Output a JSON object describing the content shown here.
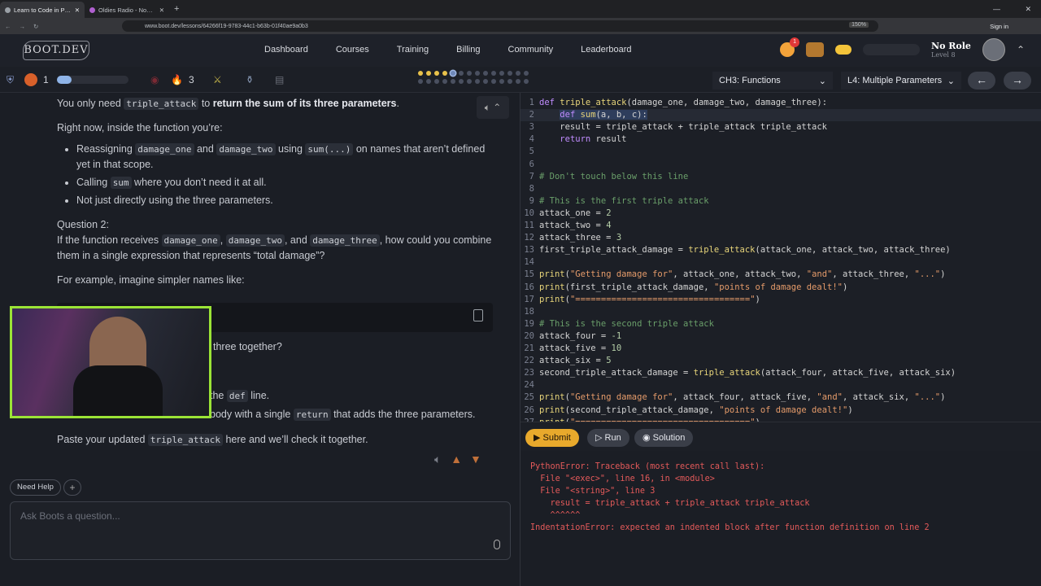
{
  "browser": {
    "tabs": [
      {
        "title": "Learn to Code in Python: N",
        "active": true
      },
      {
        "title": "Oldies Radio - Now Play",
        "active": false
      }
    ],
    "url": "www.boot.dev/lessons/64266f19-9783-44c1-b63b-01f40ae9a0b3",
    "zoom": "150%",
    "signin_label": "Sign in"
  },
  "header": {
    "logo": "BOOT.DEV",
    "nav": [
      "Dashboard",
      "Courses",
      "Training",
      "Billing",
      "Community",
      "Leaderboard"
    ],
    "notification_count": "1",
    "role": "No Role",
    "level": "Level 8"
  },
  "subbar": {
    "gem_count": "1",
    "fire_count": "3",
    "xp_progress": 0.2,
    "chapter": "CH3: Functions",
    "lesson": "L4: Multiple Parameters",
    "progress_rows": [
      [
        "y",
        "y",
        "y",
        "y",
        "c",
        "d",
        "d",
        "d",
        "d",
        "d",
        "d",
        "d",
        "d",
        "d"
      ],
      [
        "d",
        "d",
        "d",
        "d",
        "d",
        "d",
        "d",
        "d",
        "d",
        "d",
        "d",
        "d",
        "d",
        "d"
      ]
    ]
  },
  "chat": {
    "p1_a": "You only need ",
    "p1_code": "triple_attack",
    "p1_b": " to ",
    "p1_bold": "return the sum of its three parameters",
    "p1_c": ".",
    "p2": "Right now, inside the function you’re:",
    "b1_a": "Reassigning ",
    "b1_c1": "damage_one",
    "b1_b": " and ",
    "b1_c2": "damage_two",
    "b1_c": " using ",
    "b1_c3": "sum(...)",
    "b1_d": " on names that aren’t defined yet in that scope.",
    "b2_a": "Calling ",
    "b2_c": "sum",
    "b2_b": " where you don’t need it at all.",
    "b3": "Not just directly using the three parameters.",
    "q2_title": "Question 2:",
    "q2_a": "If the function receives ",
    "q2_c1": "damage_one",
    "q2_sep": ", ",
    "q2_c2": "damage_two",
    "q2_b": ", and ",
    "q2_c3": "damage_three",
    "q2_c": ", how could you combine them in a single expression that represents “total damage”?",
    "p3": "For example, imagine simpler names like:",
    "partial1": "three together?",
    "partial2_a": "the ",
    "partial2_code": "def",
    "partial2_b": " line.",
    "partial3_a": "body with a single ",
    "partial3_code": "return",
    "partial3_b": " that adds the three parameters.",
    "p4_a": "Paste your updated ",
    "p4_code": "triple_attack",
    "p4_b": " here and we’ll check it together.",
    "need_help": "Need Help",
    "ask_placeholder": "Ask Boots a question..."
  },
  "editor_buttons": {
    "submit": "Submit",
    "run": "Run",
    "solution": "Solution"
  },
  "console": [
    "PythonError: Traceback (most recent call last):",
    "  File \"<exec>\", line 16, in <module>",
    "  File \"<string>\", line 3",
    "    result = triple_attack + triple_attack triple_attack",
    "    ^^^^^^",
    "IndentationError: expected an indented block after function definition on line 2"
  ],
  "code_lines": [
    [
      [
        "kw",
        "def "
      ],
      [
        "fn",
        "triple_attack"
      ],
      [
        "var",
        "(damage_one, damage_two, damage_three):"
      ]
    ],
    [
      [
        "var",
        "    "
      ],
      [
        "kw",
        "def "
      ],
      [
        "fn",
        "sum"
      ],
      [
        "var",
        "(a, b, c):"
      ]
    ],
    [
      [
        "var",
        "    result = triple_attack + triple_attack triple_attack"
      ]
    ],
    [
      [
        "var",
        "    "
      ],
      [
        "kw",
        "return"
      ],
      [
        "var",
        " result"
      ]
    ],
    [],
    [],
    [
      [
        "cm",
        "# Don't touch below this line"
      ]
    ],
    [],
    [
      [
        "cm",
        "# This is the first triple attack"
      ]
    ],
    [
      [
        "var",
        "attack_one = "
      ],
      [
        "num",
        "2"
      ]
    ],
    [
      [
        "var",
        "attack_two = "
      ],
      [
        "num",
        "4"
      ]
    ],
    [
      [
        "var",
        "attack_three = "
      ],
      [
        "num",
        "3"
      ]
    ],
    [
      [
        "var",
        "first_triple_attack_damage = "
      ],
      [
        "fn",
        "triple_attack"
      ],
      [
        "var",
        "(attack_one, attack_two, attack_three)"
      ]
    ],
    [],
    [
      [
        "fn",
        "print"
      ],
      [
        "var",
        "("
      ],
      [
        "str",
        "\"Getting damage for\""
      ],
      [
        "var",
        ", attack_one, attack_two, "
      ],
      [
        "str",
        "\"and\""
      ],
      [
        "var",
        ", attack_three, "
      ],
      [
        "str",
        "\"...\""
      ],
      [
        "var",
        ")"
      ]
    ],
    [
      [
        "fn",
        "print"
      ],
      [
        "var",
        "(first_triple_attack_damage, "
      ],
      [
        "str",
        "\"points of damage dealt!\""
      ],
      [
        "var",
        ")"
      ]
    ],
    [
      [
        "fn",
        "print"
      ],
      [
        "var",
        "("
      ],
      [
        "str",
        "\"==================================\""
      ],
      [
        "var",
        ")"
      ]
    ],
    [],
    [
      [
        "cm",
        "# This is the second triple attack"
      ]
    ],
    [
      [
        "var",
        "attack_four = "
      ],
      [
        "num",
        "-1"
      ]
    ],
    [
      [
        "var",
        "attack_five = "
      ],
      [
        "num",
        "10"
      ]
    ],
    [
      [
        "var",
        "attack_six = "
      ],
      [
        "num",
        "5"
      ]
    ],
    [
      [
        "var",
        "second_triple_attack_damage = "
      ],
      [
        "fn",
        "triple_attack"
      ],
      [
        "var",
        "(attack_four, attack_five, attack_six)"
      ]
    ],
    [],
    [
      [
        "fn",
        "print"
      ],
      [
        "var",
        "("
      ],
      [
        "str",
        "\"Getting damage for\""
      ],
      [
        "var",
        ", attack_four, attack_five, "
      ],
      [
        "str",
        "\"and\""
      ],
      [
        "var",
        ", attack_six, "
      ],
      [
        "str",
        "\"...\""
      ],
      [
        "var",
        ")"
      ]
    ],
    [
      [
        "fn",
        "print"
      ],
      [
        "var",
        "(second_triple_attack_damage, "
      ],
      [
        "str",
        "\"points of damage dealt!\""
      ],
      [
        "var",
        ")"
      ]
    ],
    [
      [
        "fn",
        "print"
      ],
      [
        "var",
        "("
      ],
      [
        "str",
        "\"==================================\""
      ],
      [
        "var",
        ")"
      ]
    ]
  ]
}
